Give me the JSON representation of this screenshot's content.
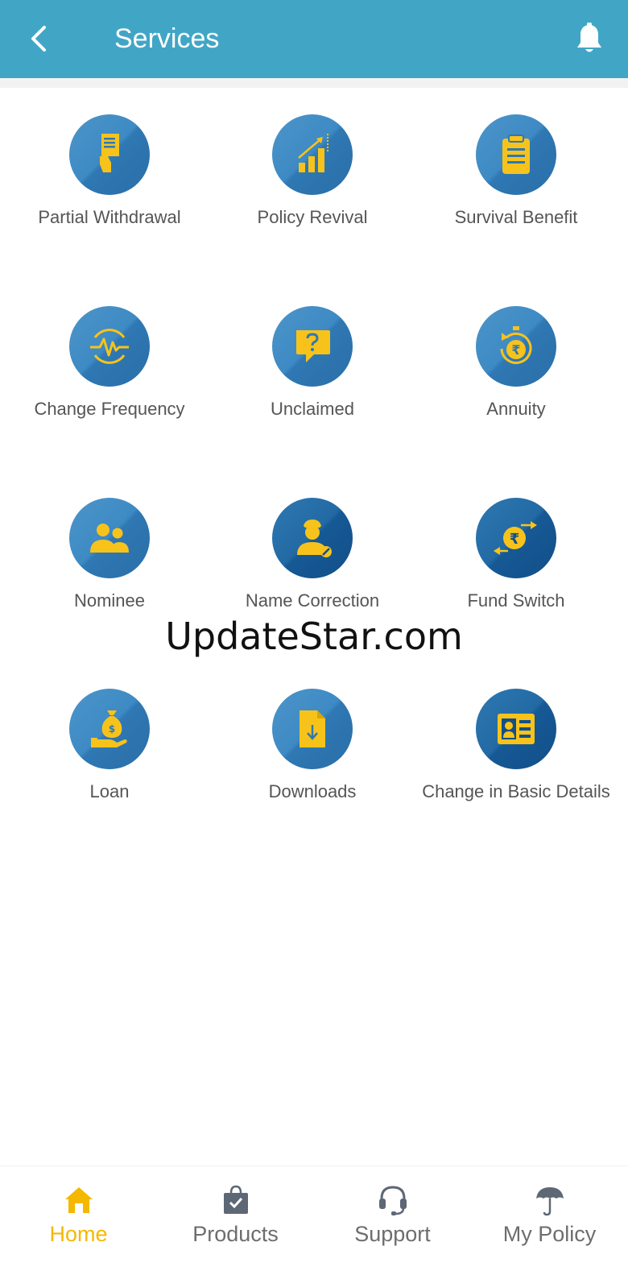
{
  "header": {
    "title": "Services",
    "back_icon": "back-arrow-icon",
    "notification_icon": "bell-icon"
  },
  "services": [
    {
      "label": "Partial Withdrawal",
      "icon": "receipt-hand-icon"
    },
    {
      "label": "Policy Revival",
      "icon": "growth-chart-icon"
    },
    {
      "label": "Survival Benefit",
      "icon": "clipboard-icon"
    },
    {
      "label": "Change Frequency",
      "icon": "frequency-wave-icon"
    },
    {
      "label": "Unclaimed",
      "icon": "question-bubble-icon"
    },
    {
      "label": "Annuity",
      "icon": "rupee-timer-icon"
    },
    {
      "label": "Nominee",
      "icon": "people-icon"
    },
    {
      "label": "Name Correction",
      "icon": "person-edit-icon"
    },
    {
      "label": "Fund Switch",
      "icon": "rupee-swap-icon"
    },
    {
      "label": "Loan",
      "icon": "money-bag-hand-icon"
    },
    {
      "label": "Downloads",
      "icon": "file-download-icon"
    },
    {
      "label": "Change in Basic Details",
      "icon": "id-card-icon"
    }
  ],
  "watermark": "UpdateStar.com",
  "bottom_nav": [
    {
      "label": "Home",
      "icon": "home-icon",
      "active": true
    },
    {
      "label": "Products",
      "icon": "shopping-bag-check-icon",
      "active": false
    },
    {
      "label": "Support",
      "icon": "headset-icon",
      "active": false
    },
    {
      "label": "My Policy",
      "icon": "umbrella-icon",
      "active": false
    }
  ],
  "colors": {
    "header": "#41a6c6",
    "icon_circle": "#3e8ac4",
    "icon_glyph": "#f7c31b",
    "label": "#555555",
    "nav_active": "#f4b800",
    "nav_inactive": "#6d6d6d"
  }
}
